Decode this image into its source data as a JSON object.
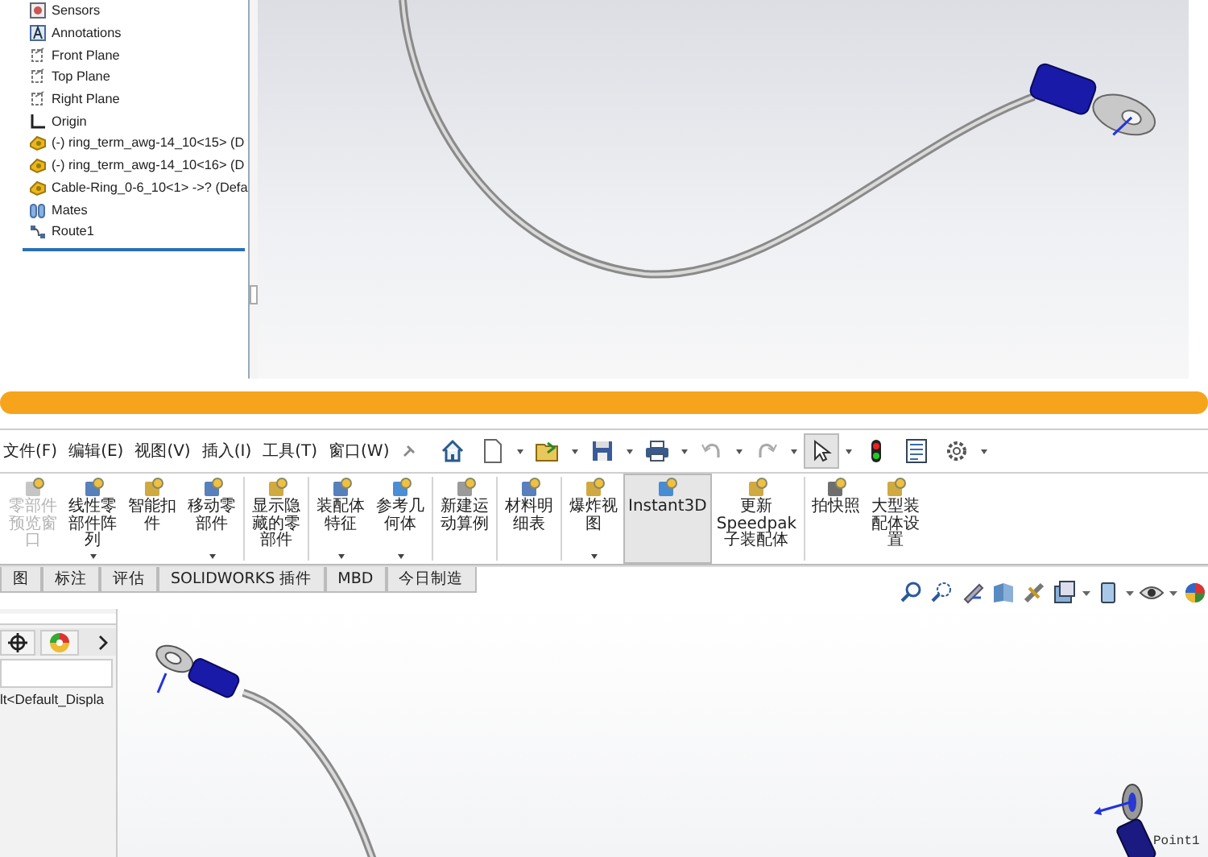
{
  "top_window": {
    "feature_tree": {
      "items": [
        {
          "label": "Sensors",
          "kind": "sensor"
        },
        {
          "label": "Annotations",
          "kind": "annotation"
        },
        {
          "label": "Front Plane",
          "kind": "plane"
        },
        {
          "label": "Top Plane",
          "kind": "plane"
        },
        {
          "label": "Right Plane",
          "kind": "plane"
        },
        {
          "label": "Origin",
          "kind": "origin"
        },
        {
          "label": "(-) ring_term_awg-14_10<15> (D",
          "kind": "part"
        },
        {
          "label": "(-) ring_term_awg-14_10<16> (D",
          "kind": "part"
        },
        {
          "label": "Cable-Ring_0-6_10<1> ->? (Defa",
          "kind": "part"
        },
        {
          "label": "Mates",
          "kind": "mates"
        },
        {
          "label": "Route1",
          "kind": "route"
        }
      ]
    }
  },
  "bottom_window": {
    "menu": [
      "文件(F)",
      "编辑(E)",
      "视图(V)",
      "插入(I)",
      "工具(T)",
      "窗口(W)"
    ],
    "toolbar": [
      {
        "kind": "home",
        "dropdown": false,
        "pressed": false
      },
      {
        "kind": "new",
        "dropdown": true,
        "pressed": false
      },
      {
        "kind": "open",
        "dropdown": true,
        "pressed": false
      },
      {
        "kind": "save",
        "dropdown": true,
        "pressed": false
      },
      {
        "kind": "print",
        "dropdown": true,
        "pressed": false
      },
      {
        "kind": "undo",
        "dropdown": true,
        "pressed": false
      },
      {
        "kind": "redo",
        "dropdown": true,
        "pressed": false
      },
      {
        "kind": "select",
        "dropdown": true,
        "pressed": true
      },
      {
        "kind": "rebuild",
        "dropdown": false,
        "pressed": false
      },
      {
        "kind": "file-properties",
        "dropdown": false,
        "pressed": false
      },
      {
        "kind": "options",
        "dropdown": true,
        "pressed": false
      }
    ],
    "ribbon": [
      {
        "label": "零部件预览窗口",
        "disabled": true,
        "dropdown": false,
        "selected": false,
        "group_end": false
      },
      {
        "label": "线性零部件阵列",
        "disabled": false,
        "dropdown": true,
        "selected": false,
        "group_end": false
      },
      {
        "label": "智能扣件",
        "disabled": false,
        "dropdown": false,
        "selected": false,
        "group_end": false
      },
      {
        "label": "移动零部件",
        "disabled": false,
        "dropdown": true,
        "selected": false,
        "group_end": true
      },
      {
        "label": "显示隐藏的零部件",
        "disabled": false,
        "dropdown": false,
        "selected": false,
        "group_end": true
      },
      {
        "label": "装配体特征",
        "disabled": false,
        "dropdown": true,
        "selected": false,
        "group_end": false
      },
      {
        "label": "参考几何体",
        "disabled": false,
        "dropdown": true,
        "selected": false,
        "group_end": true
      },
      {
        "label": "新建运动算例",
        "disabled": false,
        "dropdown": false,
        "selected": false,
        "group_end": true
      },
      {
        "label": "材料明细表",
        "disabled": false,
        "dropdown": false,
        "selected": false,
        "group_end": true
      },
      {
        "label": "爆炸视图",
        "disabled": false,
        "dropdown": true,
        "selected": false,
        "group_end": false
      },
      {
        "label": "Instant3D",
        "disabled": false,
        "dropdown": false,
        "selected": true,
        "group_end": false
      },
      {
        "label": "更新Speedpak子装配体",
        "disabled": false,
        "dropdown": false,
        "selected": false,
        "group_end": true
      },
      {
        "label": "拍快照",
        "disabled": false,
        "dropdown": false,
        "selected": false,
        "group_end": false
      },
      {
        "label": "大型装配体设置",
        "disabled": false,
        "dropdown": false,
        "selected": false,
        "group_end": false
      }
    ],
    "tabs": [
      {
        "label": "图",
        "selected": false
      },
      {
        "label": "标注",
        "selected": false
      },
      {
        "label": "评估",
        "selected": false
      },
      {
        "label": "SOLIDWORKS 插件",
        "selected": false
      },
      {
        "label": "MBD",
        "selected": false
      },
      {
        "label": "今日制造",
        "selected": false
      }
    ],
    "panel": {
      "configuration_text": "lt<Default_Displa"
    },
    "viewport": {
      "point_label": "Point1"
    }
  }
}
